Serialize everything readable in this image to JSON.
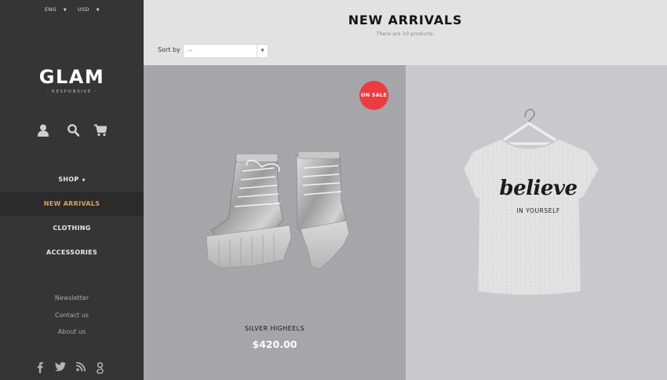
{
  "topbar": {
    "language": "ENG",
    "currency": "USD"
  },
  "logo": {
    "brand": "GLAM",
    "tagline": "· RESPONSIVE ·"
  },
  "header_icons": [
    "user-icon",
    "search-icon",
    "cart-icon"
  ],
  "nav": {
    "items": [
      {
        "label": "SHOP"
      },
      {
        "label": "NEW ARRIVALS",
        "active": true
      },
      {
        "label": "CLOTHING"
      },
      {
        "label": "ACCESSORIES"
      }
    ]
  },
  "footer_links": [
    {
      "label": "Newsletter"
    },
    {
      "label": "Contact us"
    },
    {
      "label": "About us"
    }
  ],
  "social": [
    "facebook-icon",
    "twitter-icon",
    "rss-icon",
    "google-plus-icon"
  ],
  "main": {
    "title": "NEW ARRIVALS",
    "subtitle": "There are 10 products.",
    "sort": {
      "label": "Sort by",
      "value": "--"
    }
  },
  "products": [
    {
      "name": "SILVER HIGHEELS",
      "price": "$420.00",
      "badge": "ON SALE"
    },
    {
      "print_main": "believe",
      "print_sub": "IN YOURSELF"
    }
  ],
  "colors": {
    "sidebar_bg": "#353535",
    "active_nav": "#d7a35a",
    "sale_badge": "#ee3b3f",
    "page_bg": "#e2e2e2"
  }
}
